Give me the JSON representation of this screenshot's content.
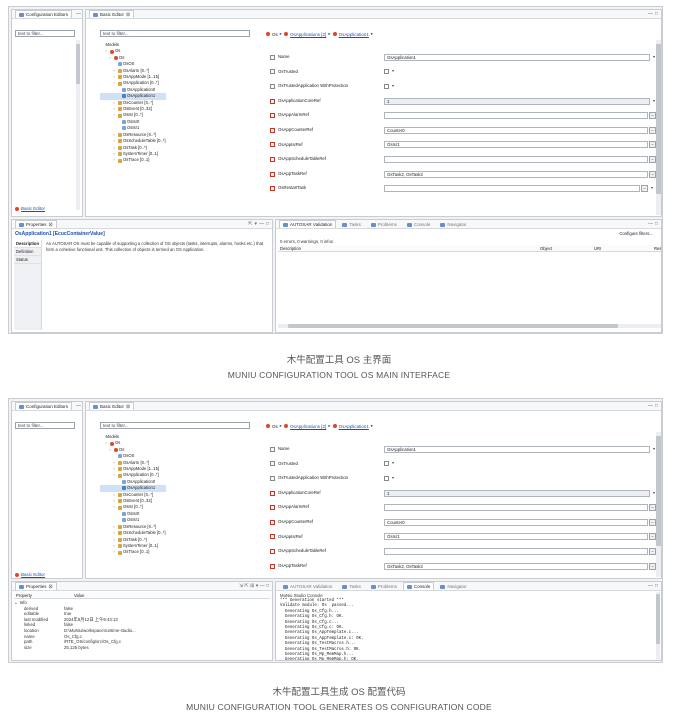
{
  "captions": {
    "main_cn": "木牛配置工具 OS 主界面",
    "main_en": "MUNIU CONFIGURATION TOOL OS MAIN INTERFACE",
    "gen_cn": "木牛配置工具生成 OS 配置代码",
    "gen_en": "MUNIU CONFIGURATION TOOL GENERATES OS CONFIGURATION CODE"
  },
  "config_editors": {
    "title": "Configuration Editors",
    "filter_placeholder": "text to filter...",
    "basic_editor_link": "Basic Editor"
  },
  "basic_editor": {
    "title": "Basic Editor",
    "filter_placeholder": "text to filter...",
    "tree": [
      {
        "label": "Models",
        "depth": 0,
        "icon": "none"
      },
      {
        "label": "Os",
        "depth": 1,
        "icon": "os"
      },
      {
        "label": "Os",
        "depth": 2,
        "icon": "os"
      },
      {
        "label": "OsOS",
        "depth": 3,
        "icon": "item"
      },
      {
        "label": "OsAlarm [0..*]",
        "depth": 3,
        "icon": "folder"
      },
      {
        "label": "OsAppMode [1..15]",
        "depth": 3,
        "icon": "folder"
      },
      {
        "label": "OsApplication [0..*]",
        "depth": 3,
        "icon": "folder"
      },
      {
        "label": "OsApplication0",
        "depth": 4,
        "icon": "item"
      },
      {
        "label": "OsApplication1",
        "depth": 4,
        "icon": "sel",
        "selected": true
      },
      {
        "label": "OsCounter [0..*]",
        "depth": 3,
        "icon": "folder"
      },
      {
        "label": "OsEvent [0..32]",
        "depth": 3,
        "icon": "folder"
      },
      {
        "label": "OsIsr [0..*]",
        "depth": 3,
        "icon": "folder"
      },
      {
        "label": "OsIsr0",
        "depth": 4,
        "icon": "item"
      },
      {
        "label": "OsIsr1",
        "depth": 4,
        "icon": "item"
      },
      {
        "label": "OsResource [0..*]",
        "depth": 3,
        "icon": "folder"
      },
      {
        "label": "OsScheduleTable [0..*]",
        "depth": 3,
        "icon": "folder"
      },
      {
        "label": "OsTask [0..*]",
        "depth": 3,
        "icon": "folder"
      },
      {
        "label": "SystemTimer [0..1]",
        "depth": 3,
        "icon": "folder"
      },
      {
        "label": "OsTrace [0..1]",
        "depth": 3,
        "icon": "folder"
      }
    ]
  },
  "breadcrumb": {
    "root": "Os",
    "level1": "OsApplications [2]",
    "level2": "OsApplication1"
  },
  "form_fields": [
    {
      "label": "Name",
      "value": "OsApplication1",
      "kind": "text",
      "icon": "plain"
    },
    {
      "label": "OsTrusted",
      "value": "",
      "kind": "check",
      "icon": "plain"
    },
    {
      "label": "OsTrustedApplication WithProtection",
      "value": "",
      "kind": "check",
      "icon": "plain"
    },
    {
      "label": "OsApplicationCoreRef",
      "value": "1",
      "kind": "select",
      "icon": "red"
    },
    {
      "label": "OsAppAlarmRef",
      "value": "",
      "kind": "ref",
      "icon": "red"
    },
    {
      "label": "OsAppCounterRef",
      "value": "Counter0",
      "kind": "ref",
      "icon": "red"
    },
    {
      "label": "OsAppIsrRef",
      "value": "OsIsr1",
      "kind": "ref",
      "icon": "red"
    },
    {
      "label": "OsAppScheduleTableRef",
      "value": "",
      "kind": "ref",
      "icon": "red"
    },
    {
      "label": "OsAppTaskRef",
      "value": "OsTask2, OsTask3",
      "kind": "ref",
      "icon": "red"
    },
    {
      "label": "OsRestartTask",
      "value": "",
      "kind": "ref2",
      "icon": "red"
    }
  ],
  "properties": {
    "tab": "Properties",
    "title": "OsApplication1 [EcucContainerValue]",
    "nav": [
      "Description",
      "Definition",
      "Status"
    ],
    "description": "An AUTOSAR OS must be capable of supporting a collection of OS objects (tasks, interrupts, alarms, hooks etc.) that form a cohesive functional unit. This collection of objects is termed an OS Application."
  },
  "validation": {
    "tabs": [
      "AUTOSAR Validation",
      "Tasks",
      "Problems",
      "Console",
      "Navigator"
    ],
    "configure": "Configure filters...",
    "summary": "0 errors, 0 warnings, 0 infos",
    "columns": [
      "Description",
      "Object",
      "URI",
      "Resource"
    ]
  },
  "props2": {
    "col_property": "Property",
    "col_value": "Value",
    "group": "Info",
    "rows": [
      {
        "k": "derived",
        "v": "false"
      },
      {
        "k": "editable",
        "v": "true"
      },
      {
        "k": "last modified",
        "v": "2024年8月12日 上午9:43:13"
      },
      {
        "k": "linked",
        "v": "false"
      },
      {
        "k": "location",
        "v": "D:\\MuNiu\\workspace\\runtime-studio..."
      },
      {
        "k": "name",
        "v": "Os_Cfg.c"
      },
      {
        "k": "path",
        "v": "/RTE_OS/config/src/Os_Cfg.c"
      },
      {
        "k": "size",
        "v": "25,125  bytes"
      }
    ]
  },
  "console": {
    "title": "MuNiu Studio Console",
    "lines": [
      "*** Generation started ***",
      "Validate module: Os  passed...",
      "  Generating Os_Cfg.h...",
      "  Generating Os_Cfg.h: OK.",
      "  Generating Os_Cfg.c...",
      "  Generating Os_Cfg.c: OK.",
      "  Generating Os_AppTemplate.c...",
      "  Generating Os_AppTemplate.c: OK.",
      "  Generating Os_TestMacros.h...",
      "  Generating Os_TestMacros.h: OK.",
      "  Generating Os_Mp_MemMap.h...",
      "  Generating Os_Mp_MemMap.h: OK."
    ]
  }
}
